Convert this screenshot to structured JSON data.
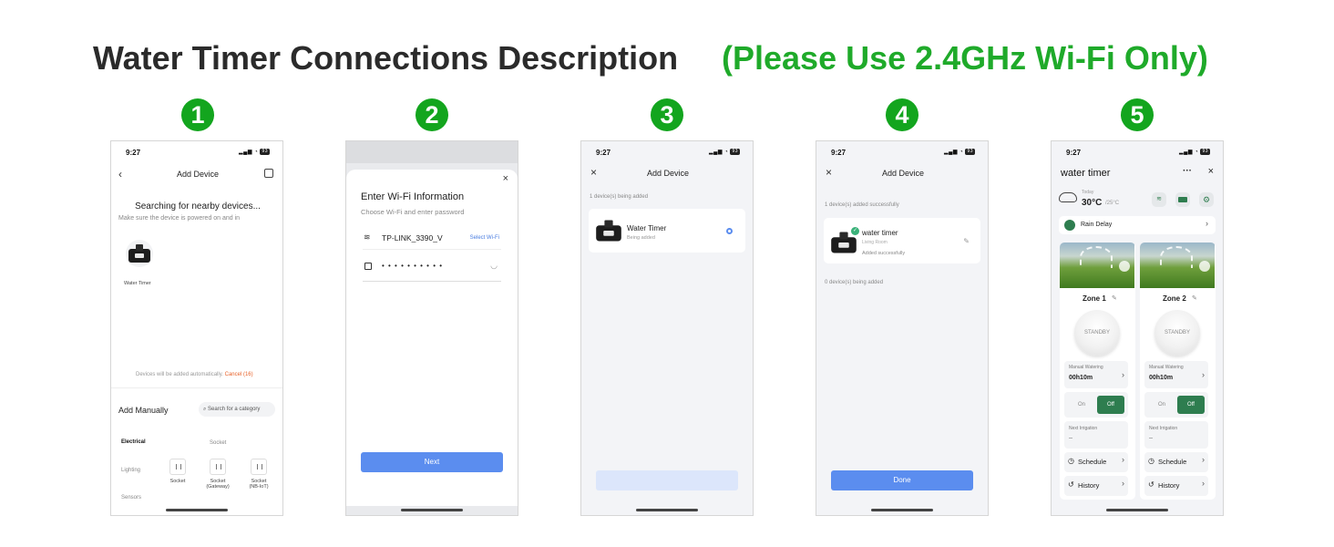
{
  "header": {
    "title": "Water Timer Connections Description",
    "note": "(Please Use 2.4GHz Wi-Fi Only)"
  },
  "colors": {
    "green": "#13a51e",
    "note_green": "#1faa2a",
    "button_blue": "#5b8def",
    "cancel_orange": "#e8632a",
    "toggle_green": "#2e7d4f"
  },
  "steps": [
    "1",
    "2",
    "3",
    "4",
    "5"
  ],
  "status_time": "9:27",
  "status_battery": "93",
  "screen1": {
    "title": "Add Device",
    "searching": "Searching for nearby devices...",
    "hint": "Make sure the device is powered on and in",
    "device_label": "Water Timer",
    "auto_text": "Devices will be added automatically.",
    "cancel": "Cancel (16)",
    "add_manually": "Add Manually",
    "search_placeholder": "Search for a category",
    "categories": [
      "Electrical",
      "Lighting",
      "Sensors"
    ],
    "group_label": "Socket",
    "items": [
      "Socket",
      "Socket\n(Gateway)",
      "Socket\n(NB-IoT)"
    ]
  },
  "screen2": {
    "title": "Enter Wi-Fi Information",
    "subtitle": "Choose Wi-Fi and enter password",
    "ssid": "TP-LINK_3390_V",
    "select_wifi": "Select Wi-Fi",
    "password_mask": "• • • • • • • • • •",
    "next": "Next"
  },
  "screen3": {
    "title": "Add Device",
    "status": "1 device(s) being added",
    "device_name": "Water Timer",
    "device_state": "Being added"
  },
  "screen4": {
    "title": "Add Device",
    "success": "1 device(s) added successfully",
    "device_name": "water timer",
    "room": "Living Room",
    "state": "Added successfully",
    "pending": "0 device(s) being added",
    "done": "Done"
  },
  "screen5": {
    "title": "water timer",
    "weather_label": "Today",
    "temp": "30°C",
    "temp_low": "/25°C",
    "rain_delay": "Rain Delay",
    "zones": [
      {
        "name": "Zone 1",
        "standby": "STANDBY",
        "manual_label": "Manual Watering",
        "manual_value": "00h10m",
        "on": "On",
        "off": "Off",
        "next_label": "Next Irrigation",
        "next_value": "--",
        "schedule": "Schedule",
        "history": "History"
      },
      {
        "name": "Zone 2",
        "standby": "STANDBY",
        "manual_label": "Manual Watering",
        "manual_value": "00h10m",
        "on": "On",
        "off": "Off",
        "next_label": "Next Irrigation",
        "next_value": "--",
        "schedule": "Schedule",
        "history": "History"
      }
    ]
  }
}
